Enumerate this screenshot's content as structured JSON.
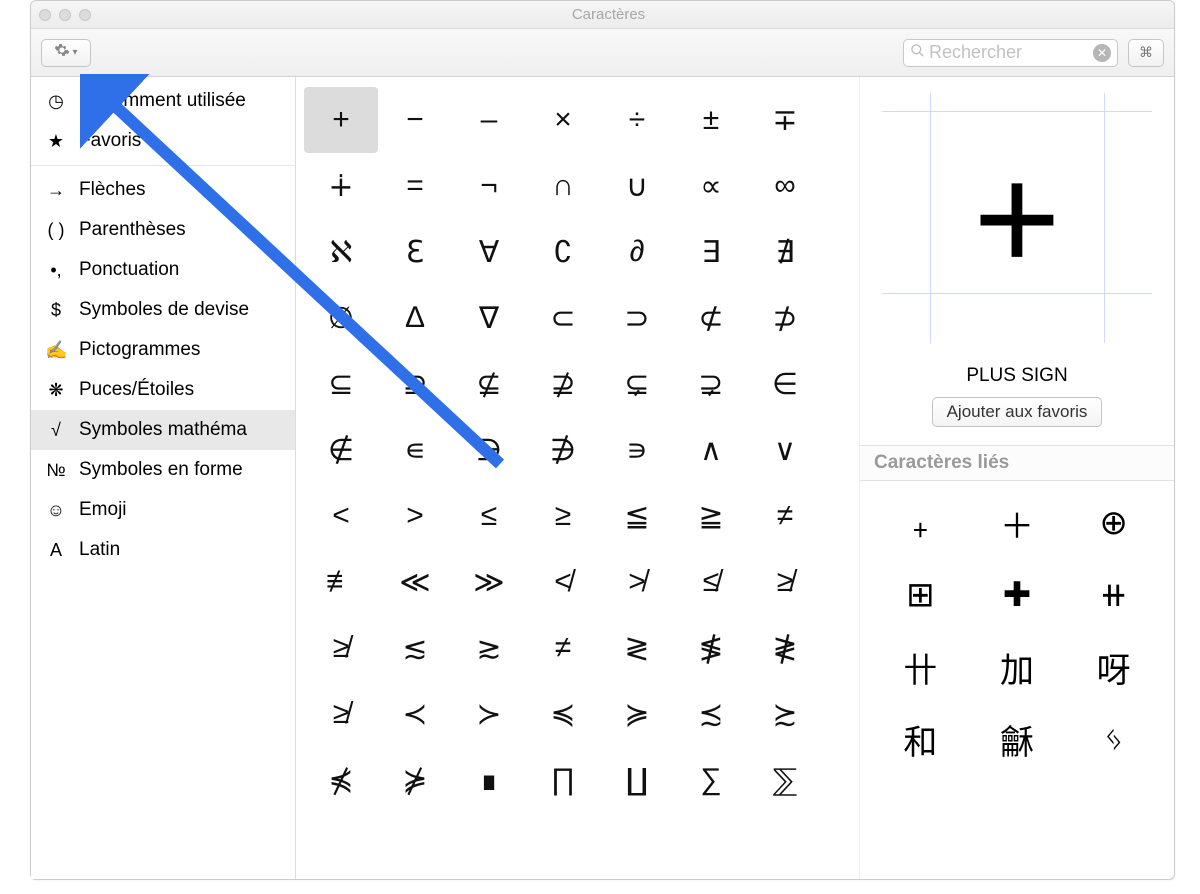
{
  "window": {
    "title": "Caractères"
  },
  "toolbar": {
    "search_placeholder": "Rechercher"
  },
  "sidebar": {
    "top": [
      {
        "icon": "◷",
        "label": "Récemment utilisée"
      },
      {
        "icon": "★",
        "label": "Favoris"
      }
    ],
    "categories": [
      {
        "icon": "→",
        "label": "Flèches"
      },
      {
        "icon": "( )",
        "label": "Parenthèses"
      },
      {
        "icon": "•,",
        "label": "Ponctuation"
      },
      {
        "icon": "$",
        "label": "Symboles de devise"
      },
      {
        "icon": "✍",
        "label": "Pictogrammes"
      },
      {
        "icon": "❋",
        "label": "Puces/Étoiles"
      },
      {
        "icon": "√",
        "label": "Symboles mathéma",
        "selected": true
      },
      {
        "icon": "№",
        "label": "Symboles en forme"
      },
      {
        "icon": "☺",
        "label": "Emoji"
      },
      {
        "icon": "A",
        "label": "Latin"
      }
    ]
  },
  "grid": {
    "selected_index": 0,
    "chars": [
      "+",
      "−",
      "‒",
      "×",
      "÷",
      "±",
      "∓",
      "∔",
      "=",
      "¬",
      "∩",
      "∪",
      "∝",
      "∞",
      "ℵ",
      "ℇ",
      "∀",
      "∁",
      "∂",
      "∃",
      "∄",
      "∅",
      "∆",
      "∇",
      "⊂",
      "⊃",
      "⊄",
      "⊅",
      "⊆",
      "⊇",
      "⊈",
      "⊉",
      "⊊",
      "⊋",
      "∈",
      "∉",
      "∊",
      "∋",
      "∌",
      "∍",
      "∧",
      "∨",
      "<",
      ">",
      "≤",
      "≥",
      "≦",
      "≧",
      "≠",
      "≢",
      "≪",
      "≫",
      "≮",
      "≯",
      "≰",
      "≱",
      "≱",
      "≲",
      "≳",
      "≠",
      "≷",
      "≸",
      "≹",
      "≱",
      "≺",
      "≻",
      "≼",
      "≽",
      "≾",
      "≿",
      "⋠",
      "⋡",
      "∎",
      "∏",
      "∐",
      "∑",
      "⅀"
    ]
  },
  "detail": {
    "char": "+",
    "name": "PLUS SIGN",
    "add_favorite_label": "Ajouter aux favoris",
    "related_heading": "Caractères liés",
    "related": [
      "﹢",
      "＋",
      "⊕",
      "⊞",
      "✚",
      "⧺",
      "卄",
      "加",
      "呀",
      "和",
      "龢",
      "ᛃ"
    ]
  }
}
